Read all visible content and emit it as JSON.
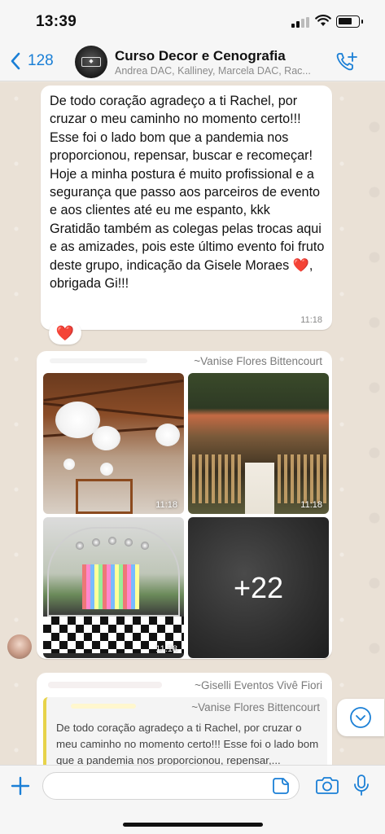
{
  "status_bar": {
    "time": "13:39"
  },
  "header": {
    "back_count": "128",
    "group_name": "Curso Decor e Cenografia",
    "members": "Andrea DAC, Kalliney, Marcela DAC, Rac..."
  },
  "messages": {
    "first": {
      "text": "De todo coração agradeço a ti Rachel, por cruzar o meu caminho no momento certo!!!\nEsse foi o lado bom que a pandemia nos proporcionou, repensar, buscar e recomeçar!\nHoje a minha postura é muito profissional e a segurança que passo aos parceiros de evento e aos clientes até eu me espanto, kkk\nGratidão também as colegas pelas trocas aqui e as amizades, pois este último evento foi fruto deste grupo, indicação da Gisele Moraes ❤️, obrigada Gi!!!",
      "time": "11:18",
      "reaction": "❤️"
    },
    "album": {
      "sender": "~Vanise Flores Bittencourt",
      "photo_times": [
        "11:18",
        "11:18",
        "11:18"
      ],
      "more_count": "+22"
    },
    "reply": {
      "sender": "~Giselli Eventos Vivê Fiori",
      "quoted_sender": "~Vanise Flores Bittencourt",
      "quoted_text": "De todo coração agradeço a ti Rachel, por cruzar o meu caminho no momento certo!!! Esse foi o lado bom que a pandemia nos proporcionou, repensar,..."
    }
  },
  "icons": {
    "back": "chevron-left-icon",
    "add_call": "phone-plus-icon",
    "plus": "plus-icon",
    "sticker": "sticker-icon",
    "camera": "camera-icon",
    "mic": "microphone-icon",
    "scroll": "chevron-down-icon"
  },
  "colors": {
    "accent": "#1a7fd6",
    "quote_bar": "#e7d34a"
  }
}
